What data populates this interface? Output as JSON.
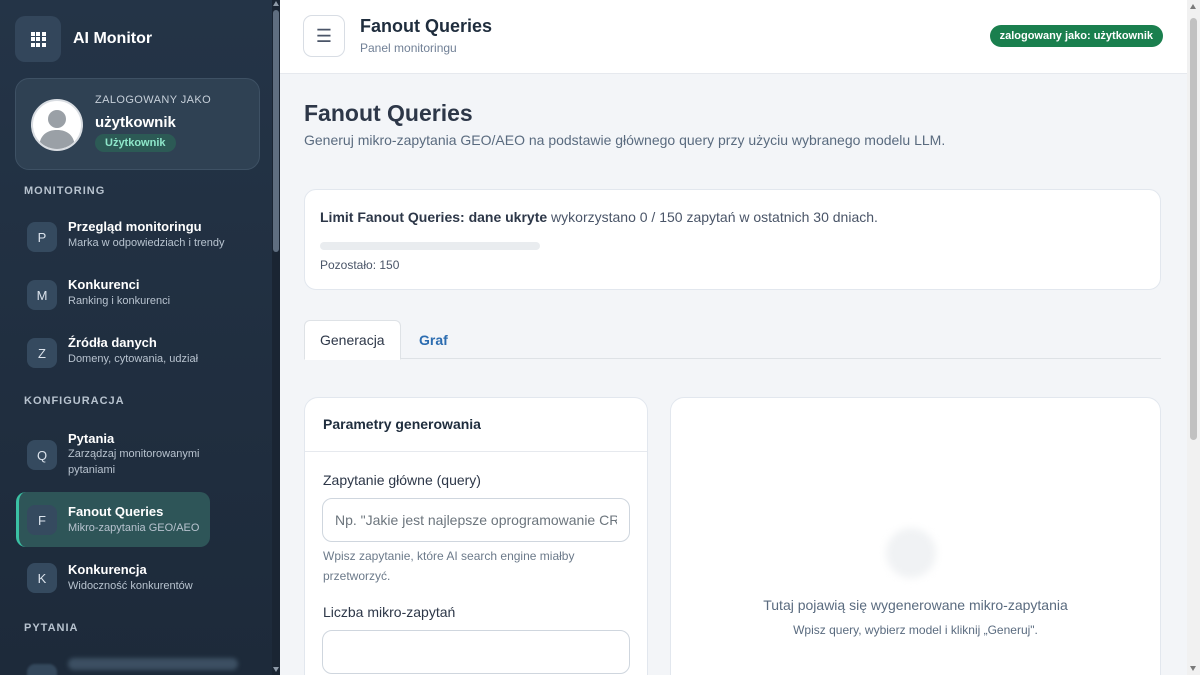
{
  "app": {
    "brand": "AI Monitor"
  },
  "user": {
    "caption": "ZALOGOWANY JAKO",
    "name": "użytkownik",
    "role": "Użytkownik"
  },
  "sidebar": {
    "sections": [
      {
        "title": "MONITORING",
        "items": [
          {
            "letter": "P",
            "title": "Przegląd monitoringu",
            "sub": "Marka w odpowiedziach i trendy"
          },
          {
            "letter": "M",
            "title": "Konkurenci",
            "sub": "Ranking i konkurenci"
          },
          {
            "letter": "Z",
            "title": "Źródła danych",
            "sub": "Domeny, cytowania, udział"
          }
        ]
      },
      {
        "title": "KONFIGURACJA",
        "items": [
          {
            "letter": "Q",
            "title": "Pytania",
            "sub_line1": "Zarządzaj monitorowanymi",
            "sub_line2": "pytaniami"
          },
          {
            "letter": "F",
            "title": "Fanout Queries",
            "sub": "Mikro-zapytania GEO/AEO",
            "active": true
          },
          {
            "letter": "K",
            "title": "Konkurencja",
            "sub": "Widoczność konkurentów"
          }
        ]
      },
      {
        "title": "PYTANIA",
        "items": []
      }
    ]
  },
  "header": {
    "menu_icon": "☰",
    "title": "Fanout Queries",
    "subtitle": "Panel monitoringu",
    "login_badge": "zalogowany jako: użytkownik"
  },
  "page": {
    "title": "Fanout Queries",
    "description": "Generuj mikro-zapytania GEO/AEO na podstawie głównego query przy użyciu wybranego modelu LLM."
  },
  "limit": {
    "label": "Limit Fanout Queries: dane ukryte",
    "usage": " wykorzystano 0 / 150 zapytań w ostatnich 30 dniach.",
    "used": 0,
    "total": 150,
    "remaining_text": "Pozostało: 150"
  },
  "tabs": [
    {
      "label": "Generacja",
      "active": true
    },
    {
      "label": "Graf",
      "active": false
    }
  ],
  "params": {
    "heading": "Parametry generowania",
    "query_label": "Zapytanie główne (query)",
    "query_placeholder": "Np. \"Jakie jest najlepsze oprogramowanie CRM\"",
    "query_value": "",
    "query_hint": "Wpisz zapytanie, które AI search engine miałby przetworzyć.",
    "count_label": "Liczba mikro-zapytań",
    "count_value": ""
  },
  "results": {
    "empty_title": "Tutaj pojawią się wygenerowane mikro-zapytania",
    "empty_sub": "Wpisz query, wybierz model i kliknij „Generuj\"."
  },
  "colors": {
    "sidebar_bg": "#243447",
    "accent_active": "#3bc1a4",
    "badge_green": "#1a7f4e",
    "link_blue": "#2b6cb0"
  }
}
